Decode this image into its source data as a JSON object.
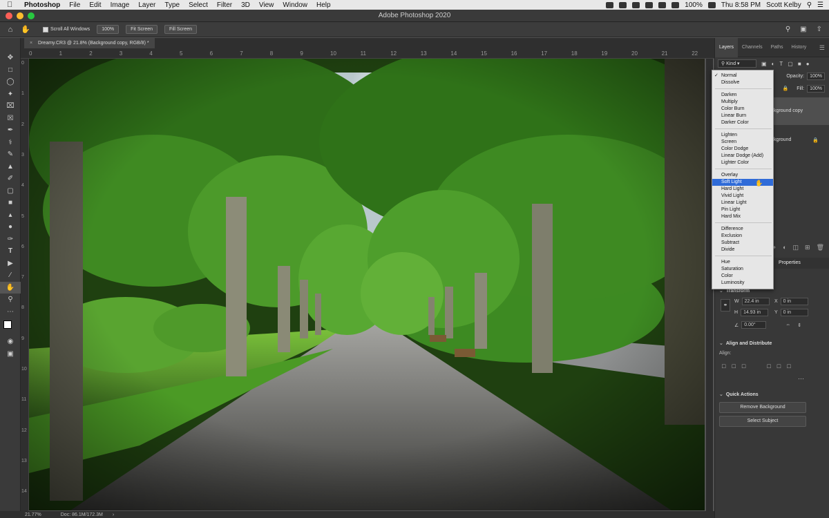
{
  "macos_menubar": {
    "app": "Photoshop",
    "items": [
      "File",
      "Edit",
      "Image",
      "Layer",
      "Type",
      "Select",
      "Filter",
      "3D",
      "View",
      "Window",
      "Help"
    ],
    "battery": "100%",
    "clock": "Thu 8:58 PM",
    "user": "Scott Kelby"
  },
  "window": {
    "title": "Adobe Photoshop 2020"
  },
  "options_bar": {
    "scroll_all_windows": "Scroll All Windows",
    "zoom_100": "100%",
    "fit_screen": "Fit Screen",
    "fill_screen": "Fill Screen"
  },
  "document": {
    "tab_title": "Dreamy.CR3 @ 21.8% (Background copy, RGB/8) *",
    "ruler_h": [
      "0",
      "1",
      "2",
      "3",
      "4",
      "5",
      "6",
      "7",
      "8",
      "9",
      "10",
      "11",
      "12",
      "13",
      "14",
      "15",
      "16",
      "17",
      "18",
      "19",
      "20",
      "21",
      "22"
    ],
    "ruler_v": [
      "0",
      "1",
      "2",
      "3",
      "4",
      "5",
      "6",
      "7",
      "8",
      "9",
      "10",
      "11",
      "12",
      "13",
      "14"
    ]
  },
  "status_bar": {
    "zoom": "21.77%",
    "doc": "Doc: 86.1M/172.3M"
  },
  "panel": {
    "tabs": [
      "Layers",
      "Channels",
      "Paths",
      "History"
    ],
    "kind": "Kind",
    "opacity_label": "Opacity:",
    "opacity_value": "100%",
    "fill_label": "Fill:",
    "fill_value": "100%",
    "layers": [
      {
        "name": "Background copy",
        "selected": true
      },
      {
        "name": "Background",
        "selected": false
      }
    ]
  },
  "blend_modes": {
    "groups": [
      [
        "Normal",
        "Dissolve"
      ],
      [
        "Darken",
        "Multiply",
        "Color Burn",
        "Linear Burn",
        "Darker Color"
      ],
      [
        "Lighten",
        "Screen",
        "Color Dodge",
        "Linear Dodge (Add)",
        "Lighter Color"
      ],
      [
        "Overlay",
        "Soft Light",
        "Hard Light",
        "Vivid Light",
        "Linear Light",
        "Pin Light",
        "Hard Mix"
      ],
      [
        "Difference",
        "Exclusion",
        "Subtract",
        "Divide"
      ],
      [
        "Hue",
        "Saturation",
        "Color",
        "Luminosity"
      ]
    ],
    "checked": "Normal",
    "highlighted": "Soft Light"
  },
  "properties": {
    "tab_label": "Properties",
    "transform_title": "Transform",
    "w_label": "W",
    "w_value": "22.4 in",
    "h_label": "H",
    "h_value": "14.93 in",
    "x_label": "X",
    "x_value": "0 in",
    "y_label": "Y",
    "y_value": "0 in",
    "angle": "0.00°",
    "align_title": "Align and Distribute",
    "align_label": "Align:",
    "quick_actions_title": "Quick Actions",
    "remove_background": "Remove Background",
    "select_subject": "Select Subject"
  },
  "tools": [
    "move-icon",
    "marquee-icon",
    "lasso-icon",
    "quick-select-icon",
    "crop-icon",
    "frame-icon",
    "eyedropper-icon",
    "healing-icon",
    "brush-icon",
    "stamp-icon",
    "history-brush-icon",
    "eraser-icon",
    "gradient-icon",
    "blur-icon",
    "dodge-icon",
    "pen-icon",
    "type-icon",
    "path-select-icon",
    "line-icon",
    "hand-icon",
    "zoom-icon",
    "more-icon"
  ],
  "colors": {
    "highlight": "#2f6bd8",
    "panel_bg": "#383838",
    "foliage": "#3f8f2a",
    "path": "#8a8a88"
  }
}
